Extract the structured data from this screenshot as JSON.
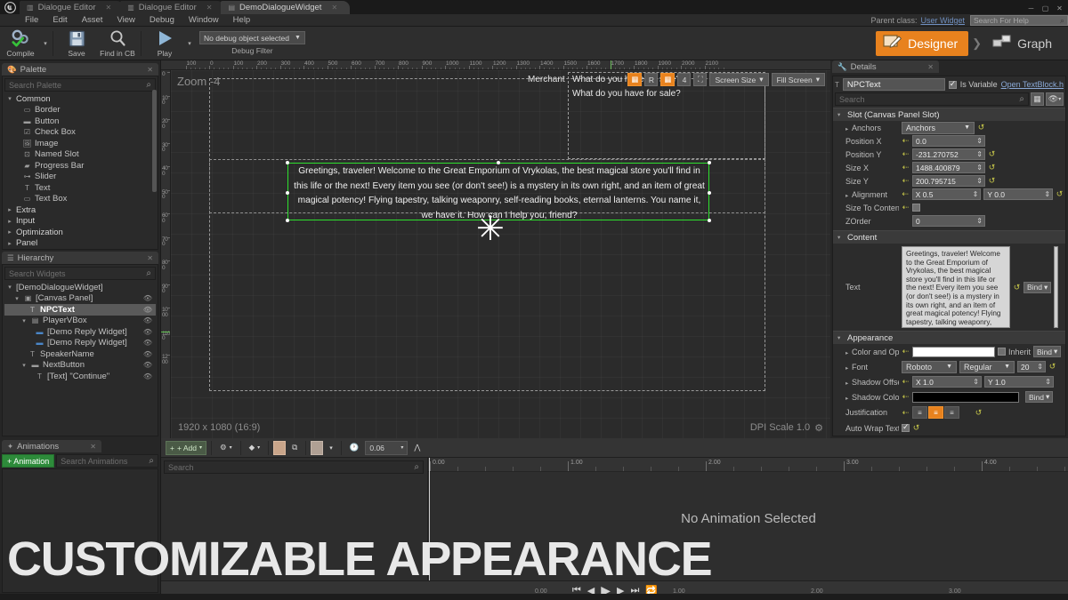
{
  "window": {
    "logo": "unreal-logo",
    "tabs": [
      {
        "label": "Dialogue Editor",
        "active": false,
        "icon": "document-icon"
      },
      {
        "label": "Dialogue Editor",
        "active": false,
        "icon": "document-icon"
      },
      {
        "label": "DemoDialogueWidget",
        "active": true,
        "icon": "widget-icon"
      }
    ],
    "controls": [
      "minimize",
      "maximize",
      "close"
    ]
  },
  "menubar": {
    "items": [
      "File",
      "Edit",
      "Asset",
      "View",
      "Debug",
      "Window",
      "Help"
    ],
    "parent_class_label": "Parent class:",
    "parent_class_value": "User Widget",
    "help_search_placeholder": "Search For Help"
  },
  "toolbar": {
    "compile_label": "Compile",
    "save_label": "Save",
    "find_label": "Find in CB",
    "play_label": "Play",
    "debug_object": "No debug object selected",
    "debug_filter_label": "Debug Filter",
    "designer_label": "Designer",
    "graph_label": "Graph",
    "accent": "#e8821e"
  },
  "palette": {
    "title": "Palette",
    "search_placeholder": "Search Palette",
    "groups": [
      {
        "label": "Common",
        "expanded": true,
        "items": [
          {
            "label": "Border",
            "icon": "border-icon"
          },
          {
            "label": "Button",
            "icon": "button-icon"
          },
          {
            "label": "Check Box",
            "icon": "checkbox-icon"
          },
          {
            "label": "Image",
            "icon": "image-icon"
          },
          {
            "label": "Named Slot",
            "icon": "named-slot-icon"
          },
          {
            "label": "Progress Bar",
            "icon": "progressbar-icon"
          },
          {
            "label": "Slider",
            "icon": "slider-icon"
          },
          {
            "label": "Text",
            "icon": "text-icon"
          },
          {
            "label": "Text Box",
            "icon": "textbox-icon"
          }
        ]
      },
      {
        "label": "Extra",
        "expanded": false,
        "items": []
      },
      {
        "label": "Input",
        "expanded": false,
        "items": []
      },
      {
        "label": "Optimization",
        "expanded": false,
        "items": []
      },
      {
        "label": "Panel",
        "expanded": false,
        "items": []
      }
    ]
  },
  "hierarchy": {
    "title": "Hierarchy",
    "search_placeholder": "Search Widgets",
    "nodes": [
      {
        "label": "[DemoDialogueWidget]",
        "depth": 0,
        "arrow": "▾",
        "icon": "",
        "eye": false,
        "selected": false
      },
      {
        "label": "[Canvas Panel]",
        "depth": 1,
        "arrow": "▾",
        "icon": "canvas-icon",
        "eye": true,
        "selected": false
      },
      {
        "label": "NPCText",
        "depth": 2,
        "arrow": "",
        "icon": "text-icon",
        "eye": true,
        "selected": true
      },
      {
        "label": "PlayerVBox",
        "depth": 2,
        "arrow": "▾",
        "icon": "vbox-icon",
        "eye": true,
        "selected": false
      },
      {
        "label": "[Demo Reply Widget]",
        "depth": 3,
        "arrow": "",
        "icon": "widget-blue-icon",
        "eye": true,
        "selected": false
      },
      {
        "label": "[Demo Reply Widget]",
        "depth": 3,
        "arrow": "",
        "icon": "widget-blue-icon",
        "eye": true,
        "selected": false
      },
      {
        "label": "SpeakerName",
        "depth": 2,
        "arrow": "",
        "icon": "text-icon",
        "eye": true,
        "selected": false
      },
      {
        "label": "NextButton",
        "depth": 2,
        "arrow": "▾",
        "icon": "button-icon",
        "eye": true,
        "selected": false
      },
      {
        "label": "[Text] \"Continue\"",
        "depth": 3,
        "arrow": "",
        "icon": "text-icon",
        "eye": true,
        "selected": false
      }
    ]
  },
  "viewport": {
    "zoom_label": "Zoom -4",
    "resolution_label": "1920 x 1080 (16:9)",
    "dpi_label": "DPI Scale 1.0",
    "toolbar_buttons": [
      {
        "name": "snap-to-grid",
        "label": "",
        "icon": "grid-snap-icon",
        "active": true
      },
      {
        "name": "rotation-snap",
        "label": "R",
        "icon": "",
        "active": false
      },
      {
        "name": "grid-toggle",
        "label": "",
        "icon": "grid-icon",
        "active": true
      },
      {
        "name": "grid-size",
        "label": "4",
        "icon": "",
        "active": false
      },
      {
        "name": "layout-preview",
        "label": "",
        "icon": "layout-icon",
        "active": false
      }
    ],
    "screen_size_label": "Screen Size",
    "fill_screen_label": "Fill Screen",
    "ruler_h_ticks": [
      "0",
      "100",
      "0",
      "100",
      "200",
      "300",
      "400",
      "500",
      "600",
      "700",
      "800",
      "900",
      "1000",
      "1100",
      "1200",
      "1300",
      "1400",
      "1500",
      "1600",
      "1700",
      "1800",
      "1900",
      "2000",
      "2100"
    ],
    "ruler_v_ticks": [
      "0",
      "100",
      "200",
      "300",
      "400",
      "500",
      "600",
      "700",
      "800",
      "900",
      "1000",
      "1100",
      "1200"
    ],
    "widgets": {
      "speaker_name": "Merchant",
      "reply_1": "What do you have for sale?",
      "reply_2": "What do you have for sale?",
      "npc_text": "Greetings, traveler! Welcome to the Great Emporium of Vrykolas, the best magical store you'll find in this life or the next! Every item you see (or don't see!) is a mystery in its own right, and an item of great magical potency! Flying tapestry, talking weaponry, self-reading books, eternal lanterns. You name it, we have it. How can I help you, friend?",
      "selection_color": "#2ee02e"
    }
  },
  "details": {
    "title": "Details",
    "widget_name": "NPCText",
    "is_variable_label": "Is Variable",
    "is_variable_checked": true,
    "open_link": "Open TextBlock.h",
    "search_placeholder": "Search",
    "sections": [
      {
        "label": "Slot (Canvas Panel Slot)"
      },
      {
        "label": "Content"
      },
      {
        "label": "Appearance"
      }
    ],
    "slot": {
      "anchors_label": "Anchors",
      "anchors_value": "Anchors",
      "position_x_label": "Position X",
      "position_x": "0.0",
      "position_y_label": "Position Y",
      "position_y": "-231.270752",
      "size_x_label": "Size X",
      "size_x": "1488.400879",
      "size_y_label": "Size Y",
      "size_y": "200.795715",
      "alignment_label": "Alignment",
      "alignment_x": "X  0.5",
      "alignment_y": "Y  0.0",
      "size_to_content_label": "Size To Content",
      "size_to_content_checked": false,
      "zorder_label": "ZOrder",
      "zorder": "0"
    },
    "content": {
      "text_label": "Text",
      "text_value": "Greetings, traveler! Welcome to the Great Emporium of Vrykolas, the best magical store you'll find in this life or the next! Every item you see (or don't see!) is a mystery in its own right, and an item of great magical potency! Flying tapestry, talking weaponry, self-reading books, eternal lanterns. You name it, we have it. How can I help you, friend?",
      "bind_label": "Bind"
    },
    "appearance": {
      "color_label": "Color and Opacity",
      "color_value": "#ffffff",
      "inherit_label": "Inherit",
      "font_label": "Font",
      "font_family": "Roboto",
      "font_style": "Regular",
      "font_size": "20",
      "shadow_offset_label": "Shadow Offset",
      "shadow_offset_x": "X  1.0",
      "shadow_offset_y": "Y  1.0",
      "shadow_color_label": "Shadow Color",
      "shadow_color_value": "#000000",
      "justification_label": "Justification",
      "justification_selected": "center",
      "auto_wrap_label": "Auto Wrap Text",
      "auto_wrap_checked": true,
      "bind_label": "Bind"
    }
  },
  "animations": {
    "title": "Animations",
    "add_label": "+ Animation",
    "search_placeholder": "Search Animations"
  },
  "sequencer": {
    "add_label": "+ Add",
    "time_value": "0.06",
    "search_placeholder": "Search",
    "no_animation_label": "No Animation Selected",
    "ruler_labels": [
      "0.00",
      "1.00",
      "2.00",
      "3.00",
      "4.00"
    ],
    "playhead_label": "0.00",
    "transport_icons": [
      "step-back-start",
      "step-back",
      "play",
      "step-forward",
      "step-forward-end",
      "loop"
    ]
  },
  "overlay": {
    "headline": "CUSTOMIZABLE APPEARANCE"
  }
}
